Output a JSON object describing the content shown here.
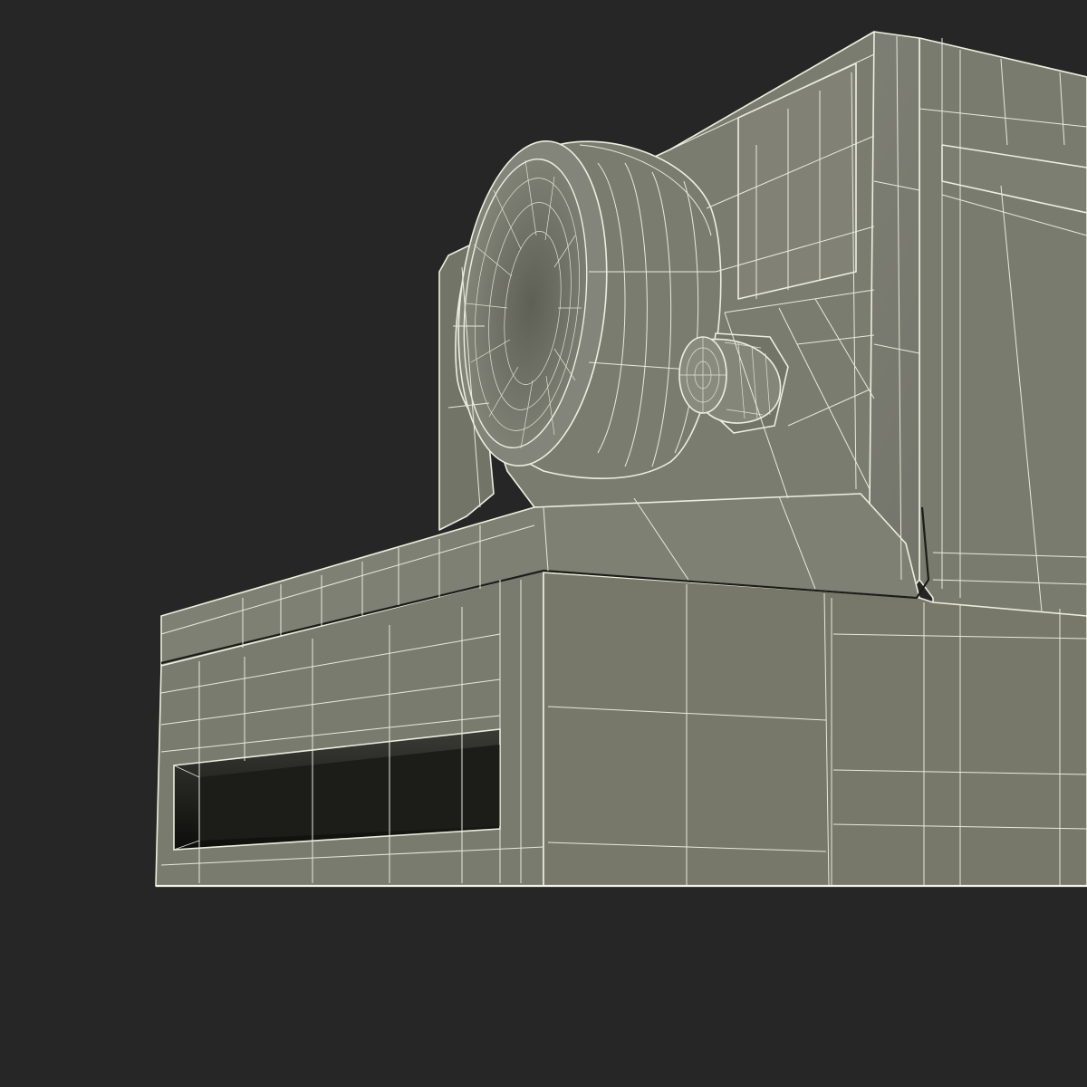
{
  "scene": {
    "background_color": "#262626",
    "model_color": "#7c7d70",
    "wire_color": "#ecefdf",
    "slot_color": "#12130f"
  }
}
